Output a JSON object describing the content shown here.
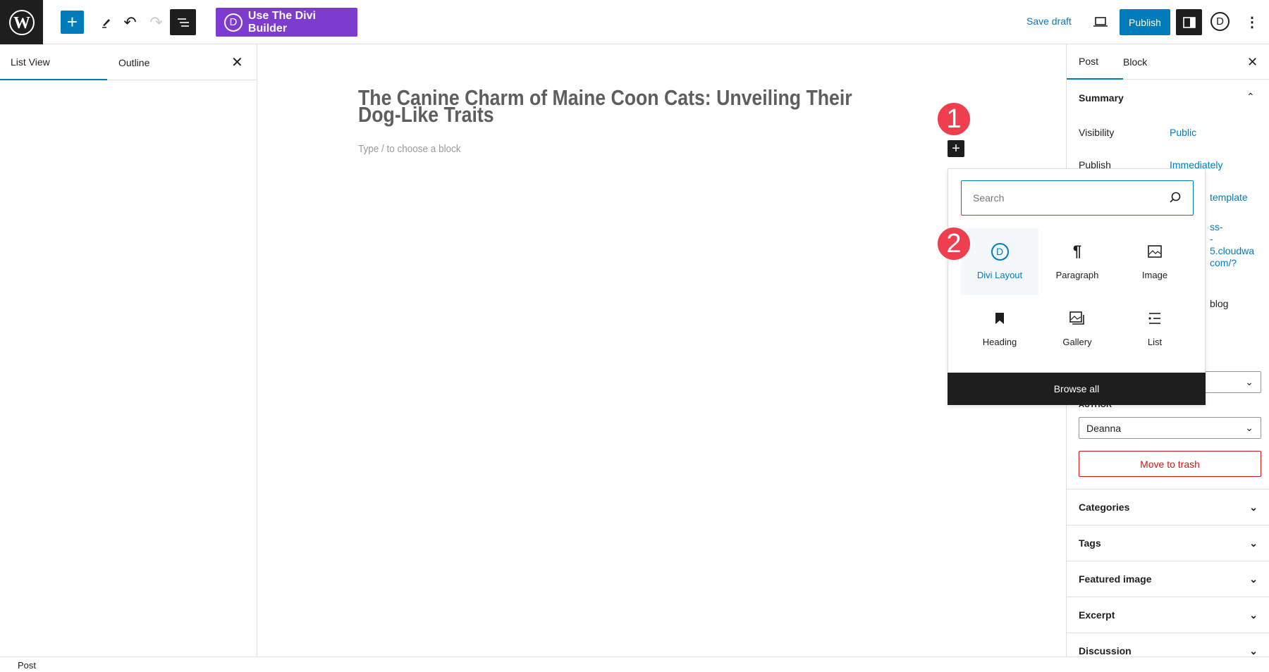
{
  "toolbar": {
    "divi_builder_label": "Use The Divi Builder",
    "divi_letter": "D",
    "save_draft": "Save draft",
    "publish": "Publish"
  },
  "left_panel": {
    "tabs": [
      "List View",
      "Outline"
    ]
  },
  "editor": {
    "title_line1": "The Canine Charm of Maine Coon Cats: Unveiling Their",
    "title_line2": "Dog-Like Traits",
    "placeholder": "Type / to choose a block"
  },
  "annotations": [
    "1",
    "2"
  ],
  "inserter": {
    "search_placeholder": "Search",
    "blocks": [
      {
        "label": "Divi Layout",
        "icon": "divi-icon"
      },
      {
        "label": "Paragraph",
        "icon": "paragraph-icon"
      },
      {
        "label": "Image",
        "icon": "image-icon"
      },
      {
        "label": "Heading",
        "icon": "bookmark-icon"
      },
      {
        "label": "Gallery",
        "icon": "gallery-icon"
      },
      {
        "label": "List",
        "icon": "list-icon"
      }
    ],
    "browse_all": "Browse all"
  },
  "sidebar": {
    "tabs": [
      "Post",
      "Block"
    ],
    "summary": "Summary",
    "visibility_label": "Visibility",
    "visibility_value": "Public",
    "publish_label": "Publish",
    "publish_value": "Immediately",
    "template_fragment": "template",
    "url_fragments": [
      "ss-",
      "-",
      "5.cloudwa",
      "com/?"
    ],
    "format_fragment": "blog",
    "author_label": "AUTHOR",
    "author_value": "Deanna",
    "move_to_trash": "Move to trash",
    "panels": [
      "Categories",
      "Tags",
      "Featured image",
      "Excerpt",
      "Discussion"
    ]
  },
  "footer": {
    "breadcrumb": "Post"
  },
  "colors": {
    "accent": "#007cba",
    "divi": "#7e3bd0",
    "badge": "#ef3f4f",
    "danger": "#cc1818"
  }
}
